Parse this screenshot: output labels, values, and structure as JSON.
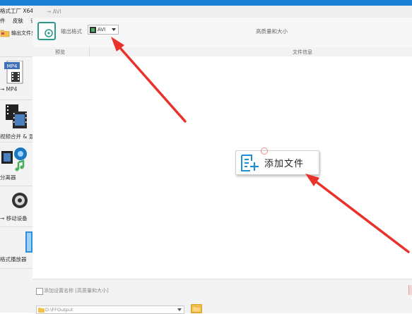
{
  "window": {
    "title_fragment": "格式工厂 X64 5",
    "menu": [
      "件",
      "皮肤",
      "语"
    ],
    "breadcrumb": "→ AVI"
  },
  "sidebar": {
    "output_folder_button": "输出文件夹",
    "categories": [
      {
        "label": "→ MP4",
        "icon": "mp4-video-icon",
        "badge": "MP4"
      },
      {
        "label": "视频合并 & 混",
        "icon": "film-merge-icon"
      },
      {
        "label": "分离器",
        "icon": "av-splitter-icon"
      },
      {
        "label": "→ 移动设备",
        "icon": "mobile-device-icon"
      },
      {
        "label": "格式播放器",
        "icon": "player-icon"
      }
    ]
  },
  "toolbar": {
    "output_format_label": "输出格式",
    "output_format_value": "AVI",
    "quality_label": "高质量和大小"
  },
  "table": {
    "columns": [
      "预览",
      "文件信息"
    ]
  },
  "main": {
    "add_file_label": "添加文件"
  },
  "bottom": {
    "append_setting_label": "添加设置名称 [高质量和大小]",
    "output_path": "D:\\FFOutput"
  },
  "colors": {
    "accent_teal": "#2d9a8c",
    "arrow_red": "#e8322b",
    "folder_yellow": "#f5c04a",
    "desktop_blue": "#1c7fd6",
    "add_icon_blue": "#1f8fd6"
  }
}
